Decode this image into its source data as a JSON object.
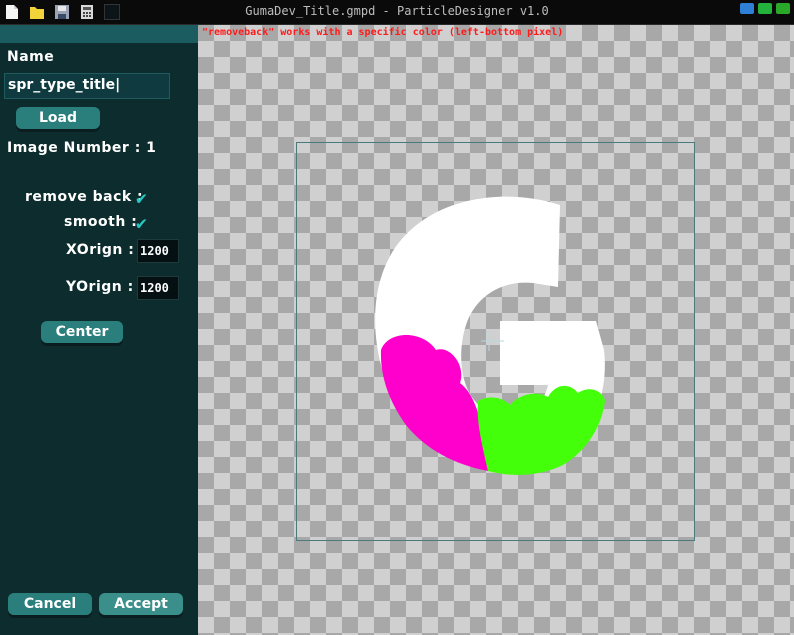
{
  "window": {
    "title": "GumaDev_Title.gmpd - ParticleDesigner v1.0",
    "toolbar_icons": [
      "new-file-icon",
      "open-folder-icon",
      "save-icon",
      "calculator-icon",
      "black-square-icon"
    ],
    "controls": [
      "minimize-button",
      "maximize-button",
      "close-button"
    ],
    "colors": {
      "minimize": "#2f7fd6",
      "maximize": "#23b23b",
      "close": "#2aa82a"
    }
  },
  "panel": {
    "name_label": "Name",
    "name_value": "spr_type_title|",
    "load_label": "Load",
    "image_number_label": "Image Number : 1",
    "remove_back_label": "remove back :",
    "smooth_label": "smooth :",
    "xorign_label": "XOrign :",
    "xorign_value": "1200",
    "yorign_label": "YOrign :",
    "yorign_value": "1200",
    "center_label": "Center",
    "cancel_label": "Cancel",
    "accept_label": "Accept",
    "remove_back_checked": true,
    "smooth_checked": true
  },
  "canvas": {
    "notice": "\"removeback\" works with a specific color (left-bottom pixel)",
    "sprite": {
      "icon": "letter-g-logo",
      "colors": {
        "body": "#ffffff",
        "left_fill": "#ff00cc",
        "right_fill": "#44ff0a"
      }
    }
  }
}
